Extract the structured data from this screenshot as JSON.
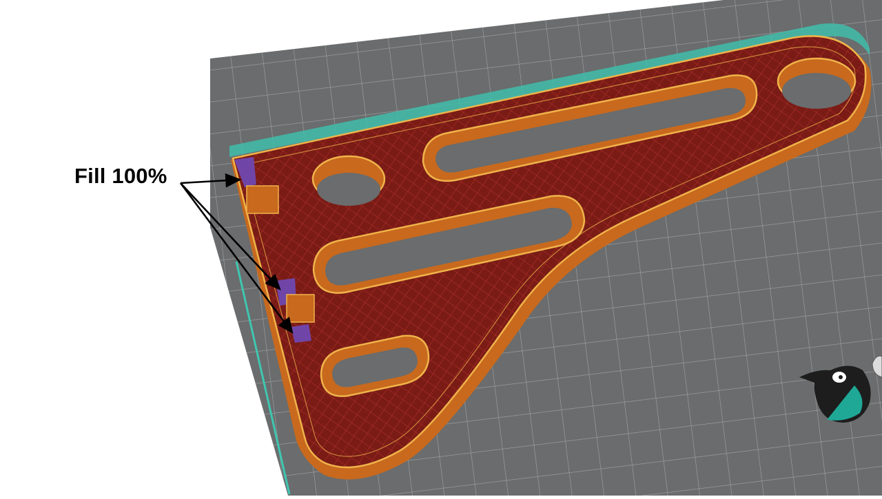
{
  "annotation": {
    "label": "Fill 100%"
  },
  "scene": {
    "view": "slicer-layer-preview",
    "part": "triangular-bracket",
    "icons": [
      "bird-mascot-icon",
      "arrow-icon"
    ]
  },
  "colors": {
    "background": "#ffffff",
    "build_plate": "#6a6c6d",
    "grid_line": "#a2a4a5",
    "plate_edge": "#3fc6b0",
    "perimeter": "#c8691e",
    "infill": "#7a1b16",
    "infill_hatch": "#b8352c",
    "wall_highlight": "#f0b44a",
    "support": "#7045a8",
    "arrow": "#000000"
  }
}
